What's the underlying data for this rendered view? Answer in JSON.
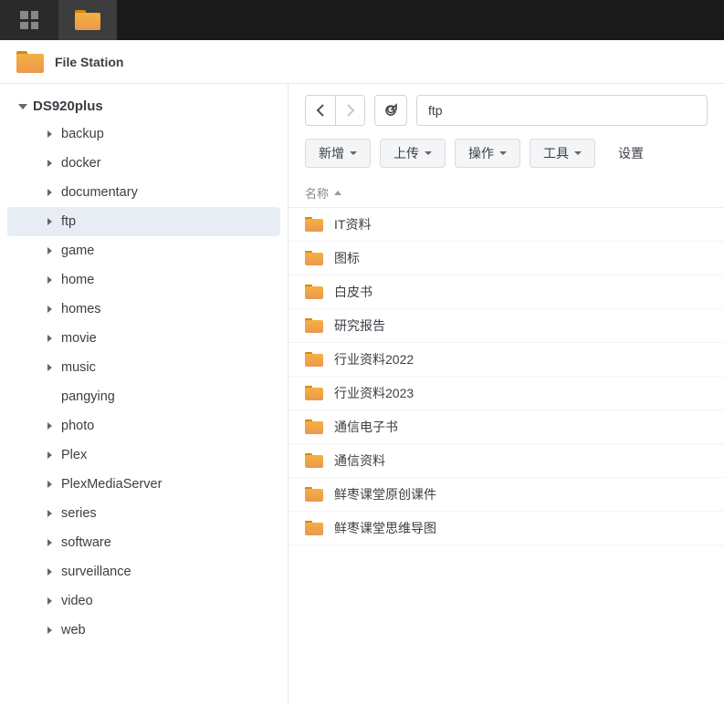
{
  "app": {
    "title": "File Station"
  },
  "taskbar": {
    "items": [
      {
        "name": "app-grid",
        "type": "grid"
      },
      {
        "name": "file-station",
        "type": "folder"
      }
    ]
  },
  "sidebar": {
    "root": "DS920plus",
    "items": [
      {
        "label": "backup",
        "has_children": true
      },
      {
        "label": "docker",
        "has_children": true
      },
      {
        "label": "documentary",
        "has_children": true
      },
      {
        "label": "ftp",
        "has_children": true,
        "selected": true
      },
      {
        "label": "game",
        "has_children": true
      },
      {
        "label": "home",
        "has_children": true
      },
      {
        "label": "homes",
        "has_children": true
      },
      {
        "label": "movie",
        "has_children": true
      },
      {
        "label": "music",
        "has_children": true
      },
      {
        "label": "pangying",
        "has_children": false
      },
      {
        "label": "photo",
        "has_children": true
      },
      {
        "label": "Plex",
        "has_children": true
      },
      {
        "label": "PlexMediaServer",
        "has_children": true
      },
      {
        "label": "series",
        "has_children": true
      },
      {
        "label": "software",
        "has_children": true
      },
      {
        "label": "surveillance",
        "has_children": true
      },
      {
        "label": "video",
        "has_children": true
      },
      {
        "label": "web",
        "has_children": true
      }
    ]
  },
  "nav": {
    "path": "ftp",
    "back_enabled": true,
    "forward_enabled": false
  },
  "actions": {
    "add": "新增",
    "upload": "上传",
    "action": "操作",
    "tools": "工具",
    "settings": "设置"
  },
  "list": {
    "header_name": "名称",
    "sort": "asc",
    "items": [
      {
        "name": "IT资料",
        "type": "folder"
      },
      {
        "name": "图标",
        "type": "folder"
      },
      {
        "name": "白皮书",
        "type": "folder"
      },
      {
        "name": "研究报告",
        "type": "folder"
      },
      {
        "name": "行业资料2022",
        "type": "folder"
      },
      {
        "name": "行业资料2023",
        "type": "folder"
      },
      {
        "name": "通信电子书",
        "type": "folder"
      },
      {
        "name": "通信资料",
        "type": "folder"
      },
      {
        "name": "鲜枣课堂原创课件",
        "type": "folder"
      },
      {
        "name": "鲜枣课堂思维导图",
        "type": "folder"
      }
    ]
  }
}
